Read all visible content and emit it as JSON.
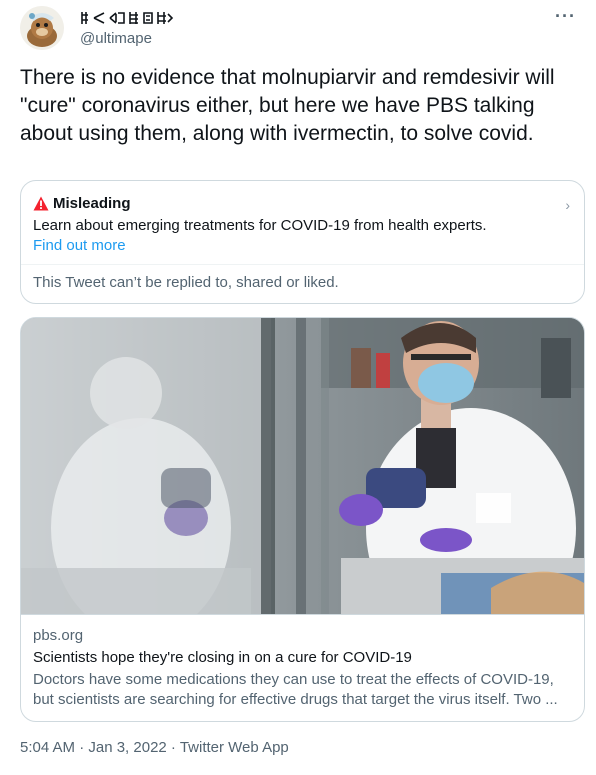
{
  "author": {
    "display_name": "𒁹𒆠𒀀𒇲𒁉𒀀𒄩𒀀",
    "name_shown": "⟪⟫",
    "handle": "@ultimape",
    "avatar": "avatar-icon"
  },
  "header": {
    "more_label": "···"
  },
  "tweet": {
    "text": "There is no evidence that molnupiarvir and remdesivir will \"cure\" coronavirus either, but here we have PBS talking about using them, along with ivermectin, to solve covid."
  },
  "notice": {
    "title": "Misleading",
    "description": "Learn about emerging treatments for COVID-19 from health experts.",
    "link": "Find out more",
    "chevron": "›",
    "restriction": "This Tweet can’t be replied to, shared or liked."
  },
  "card": {
    "domain": "pbs.org",
    "title": "Scientists hope they're closing in on a cure for COVID-19",
    "description": "Doctors have some medications they can use to treat the effects of COVID-19, but scientists are searching for effective drugs that target the virus itself. Two ..."
  },
  "meta": {
    "timestamp": "5:04 AM · Jan 3, 2022 · Twitter Web App"
  },
  "colors": {
    "link": "#1d9bf0",
    "warning": "#f4212e",
    "secondary_text": "#536471",
    "border": "#cfd9de"
  }
}
